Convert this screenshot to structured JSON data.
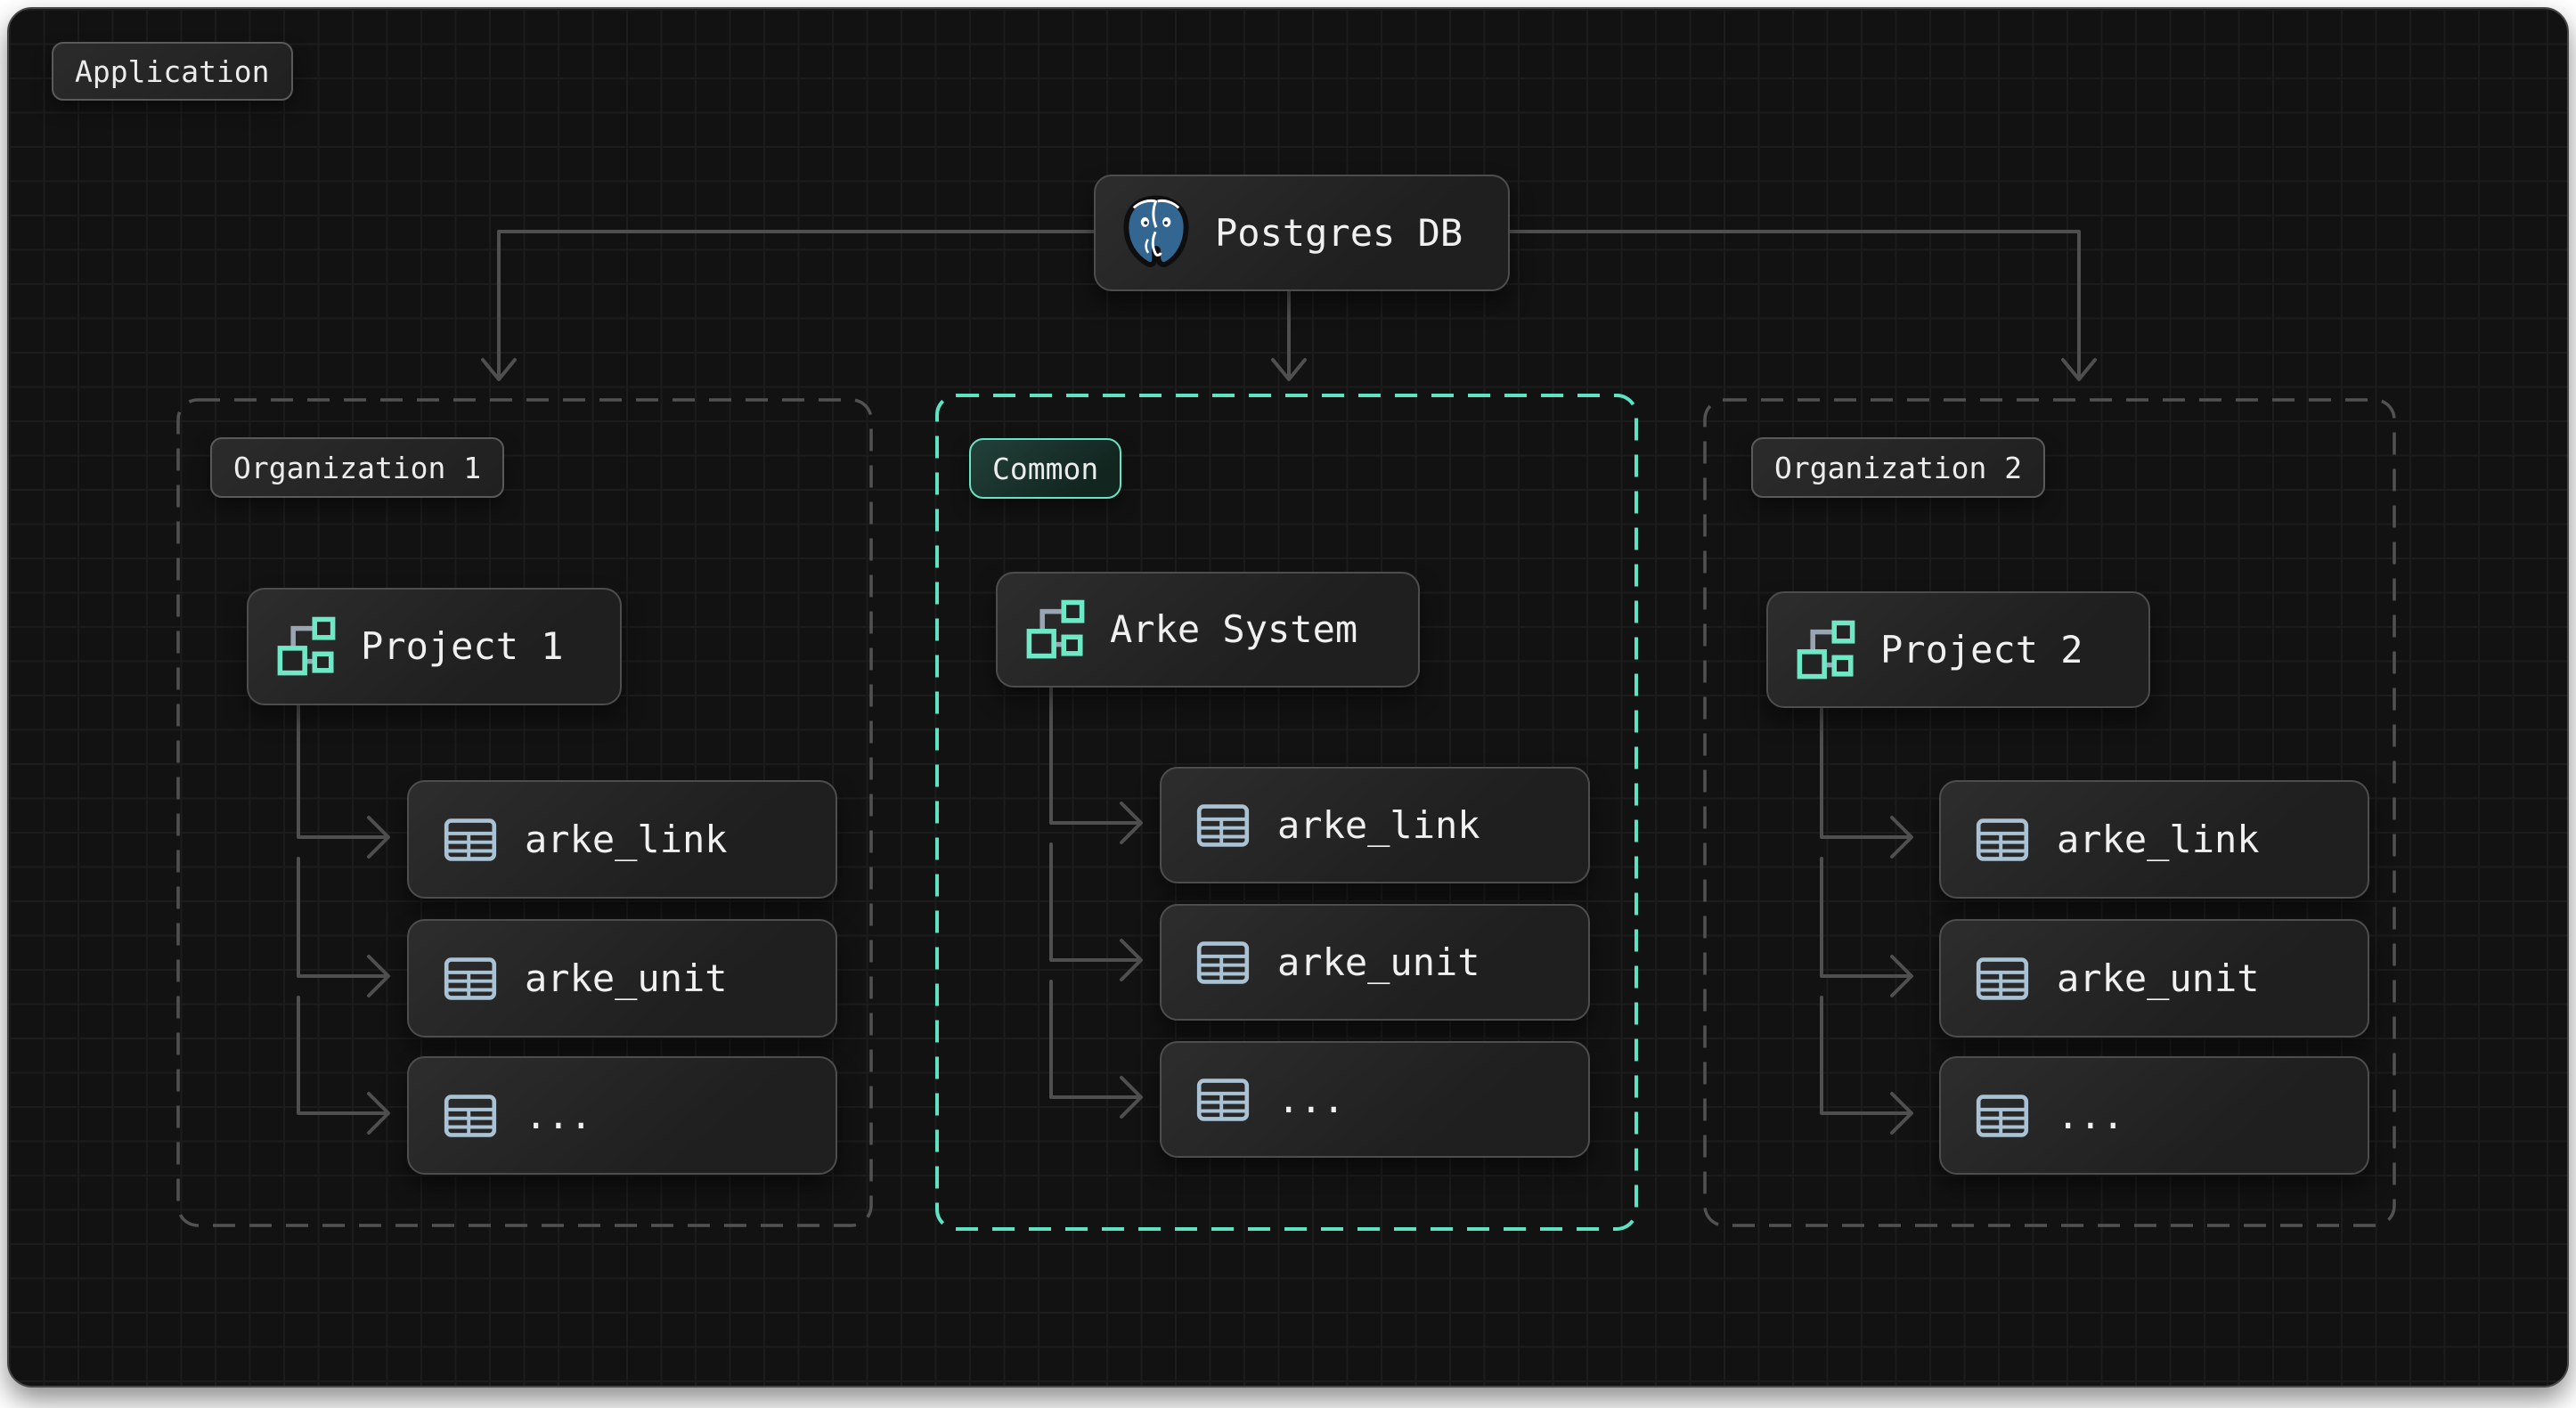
{
  "diagram": {
    "application_label": "Application",
    "database": {
      "label": "Postgres DB",
      "icon": "postgresql-elephant-icon"
    },
    "containers": {
      "org1": {
        "label": "Organization 1",
        "project": {
          "label": "Project 1",
          "icon": "project-nodes-icon"
        },
        "tables": [
          "arke_link",
          "arke_unit",
          "..."
        ]
      },
      "common": {
        "label": "Common",
        "project": {
          "label": "Arke System",
          "icon": "project-nodes-icon"
        },
        "tables": [
          "arke_link",
          "arke_unit",
          "..."
        ]
      },
      "org2": {
        "label": "Organization 2",
        "project": {
          "label": "Project 2",
          "icon": "project-nodes-icon"
        },
        "tables": [
          "arke_link",
          "arke_unit",
          "..."
        ]
      }
    },
    "colors": {
      "canvas_bg": "#121212",
      "grid_line": "#1c1c1c",
      "node_border": "#4d4d4d",
      "connector_gray": "#4f4f4f",
      "accent_teal": "#5ee3c2",
      "table_icon": "#a9c2d4",
      "project_icon_teal": "#6fe8c5",
      "postgres_blue": "#336791",
      "text": "#f0f0f0"
    }
  }
}
